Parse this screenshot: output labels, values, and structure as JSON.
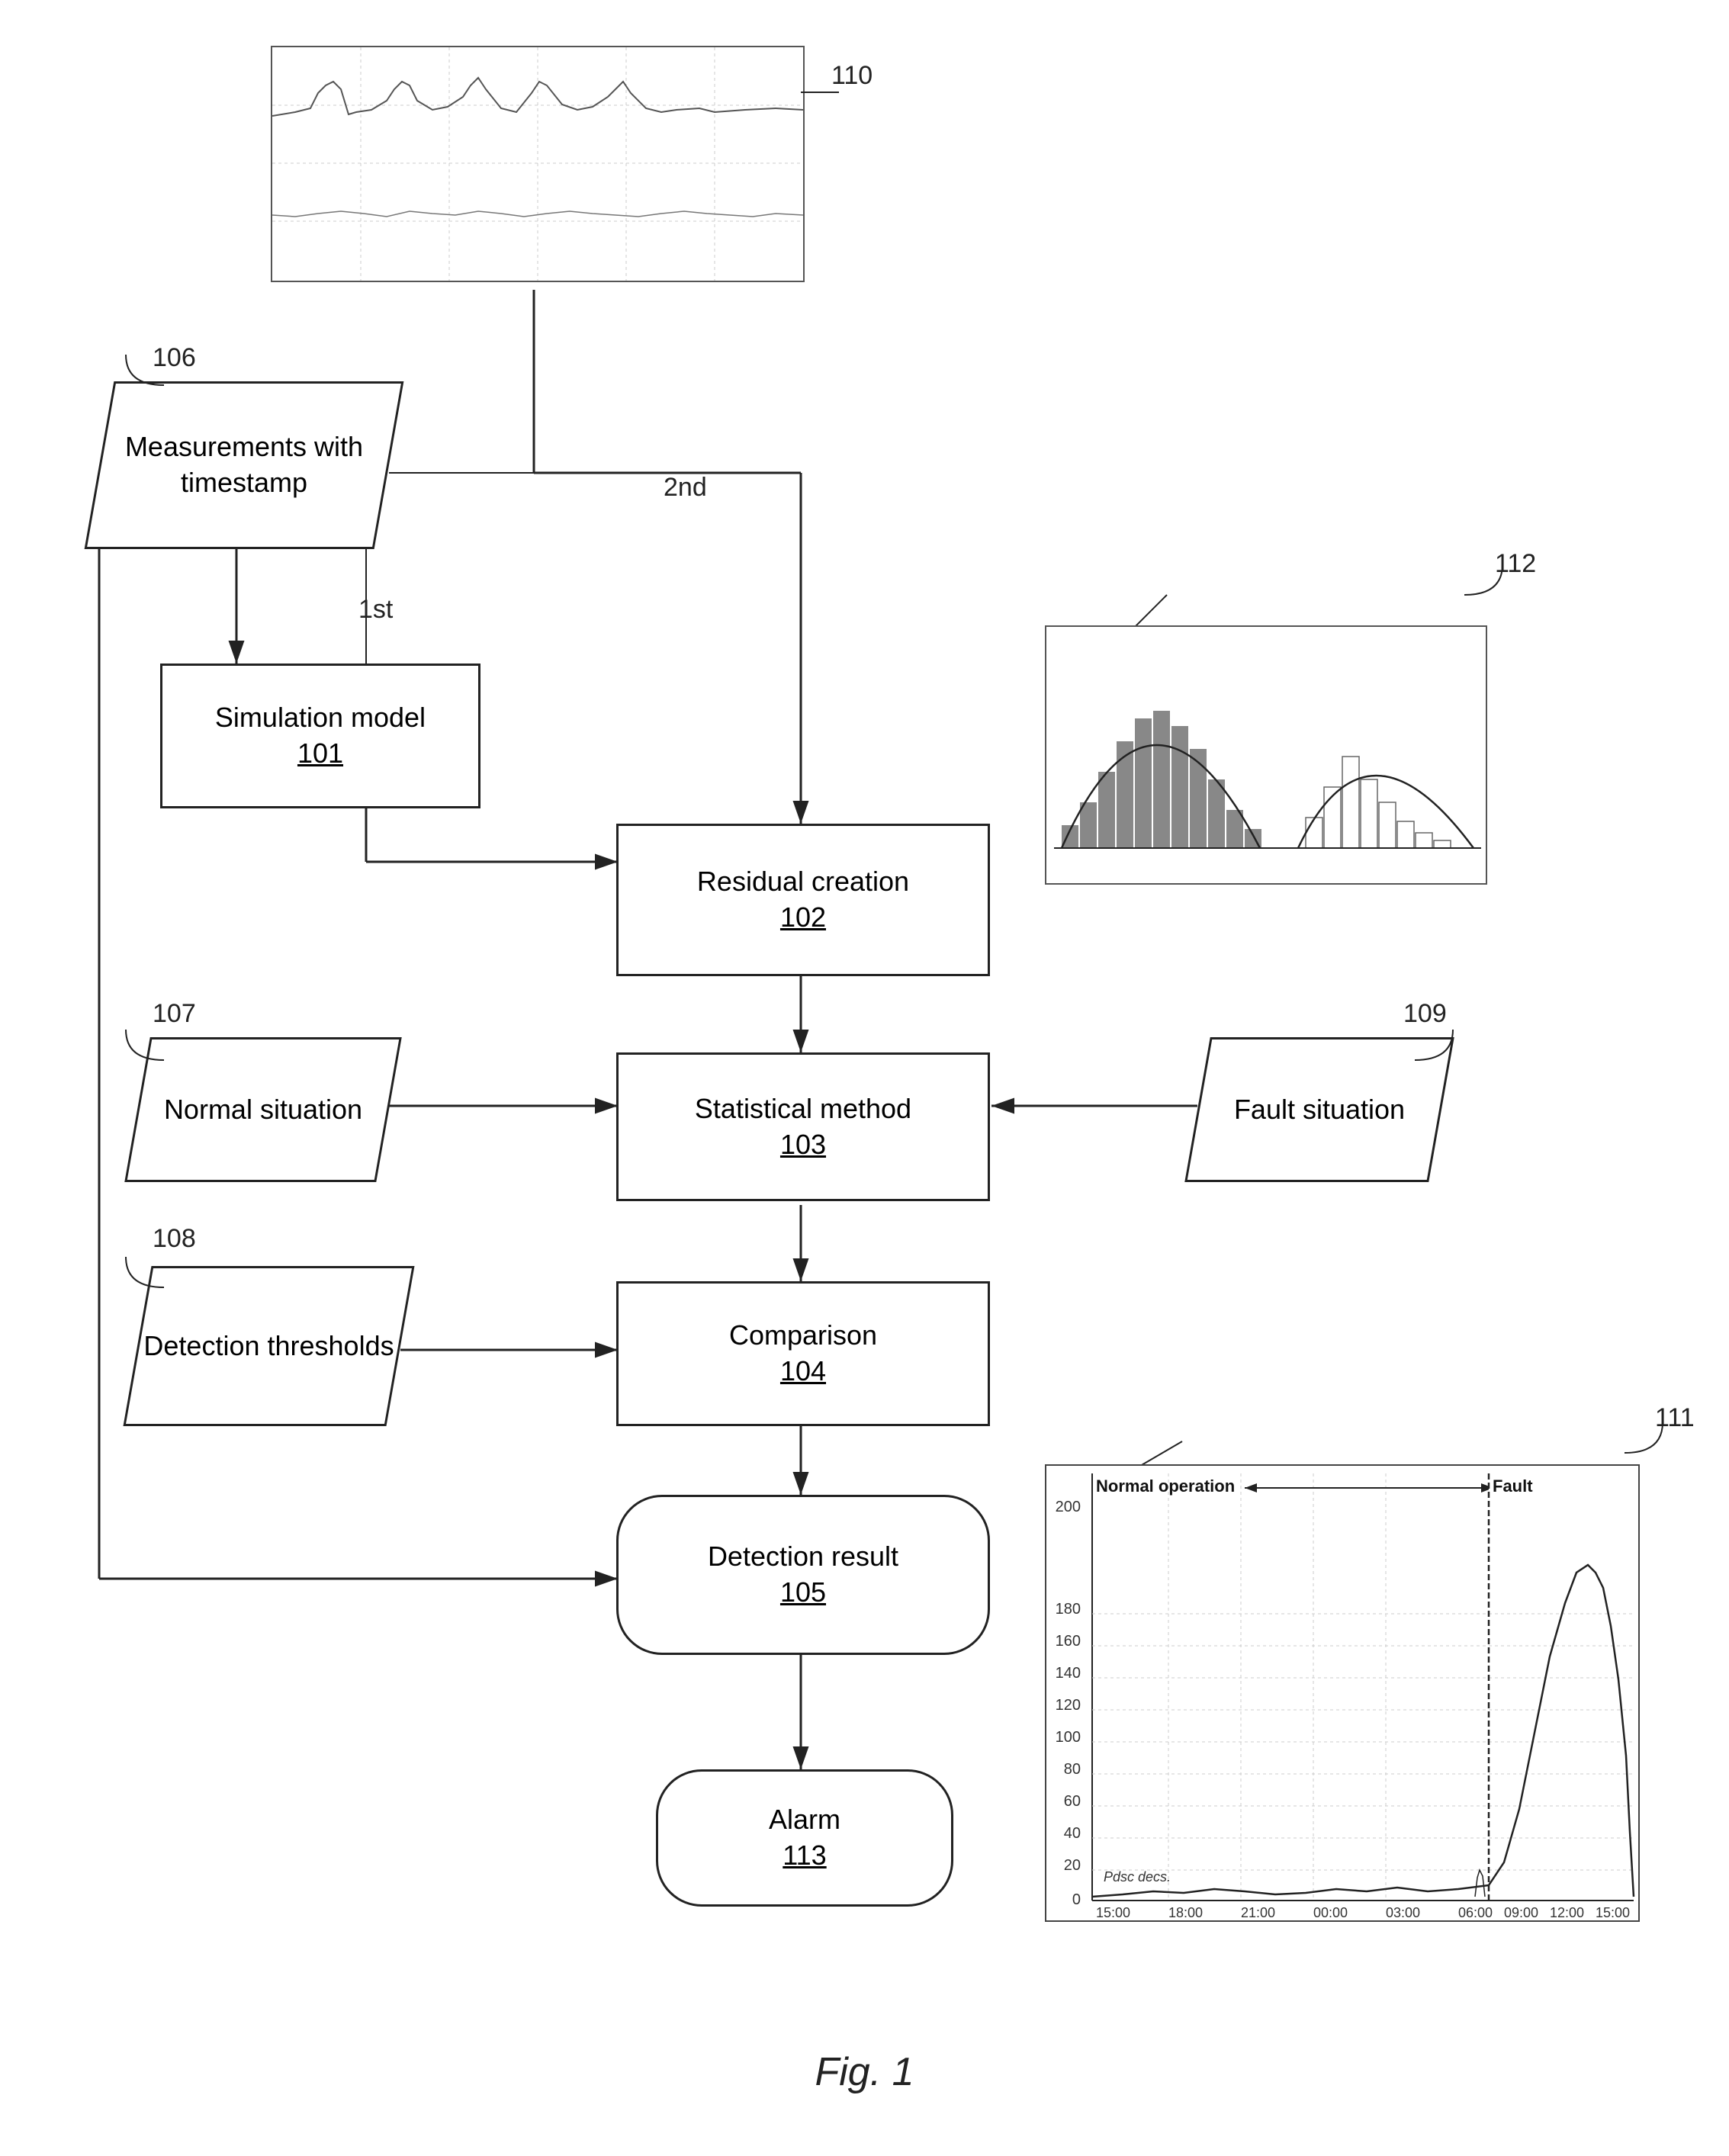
{
  "title": "Fig. 1",
  "nodes": {
    "simulation_model": {
      "label": "Simulation model",
      "number": "101",
      "type": "rect"
    },
    "residual_creation": {
      "label": "Residual creation",
      "number": "102",
      "type": "rect"
    },
    "statistical_method": {
      "label": "Statistical method",
      "number": "103",
      "type": "rect"
    },
    "comparison": {
      "label": "Comparison",
      "number": "104",
      "type": "rect"
    },
    "detection_result": {
      "label": "Detection result",
      "number": "105",
      "type": "rounded"
    },
    "alarm": {
      "label": "Alarm",
      "number": "113",
      "type": "rounded"
    },
    "measurements": {
      "label": "Measurements with timestamp",
      "number": "106",
      "type": "parallelogram"
    },
    "normal_situation": {
      "label": "Normal situation",
      "number": "107",
      "type": "parallelogram"
    },
    "detection_thresholds": {
      "label": "Detection thresholds",
      "number": "108",
      "type": "parallelogram"
    },
    "fault_situation": {
      "label": "Fault situation",
      "number": "109",
      "type": "parallelogram"
    }
  },
  "ref_numbers": {
    "r110": "110",
    "r111": "111",
    "r112": "112"
  },
  "step_labels": {
    "first": "1st",
    "second": "2nd"
  },
  "fig_caption": "Fig. 1",
  "chart_labels": {
    "normal_operation": "Normal operation",
    "fault": "Fault",
    "pdsc": "Pdsc decs."
  }
}
